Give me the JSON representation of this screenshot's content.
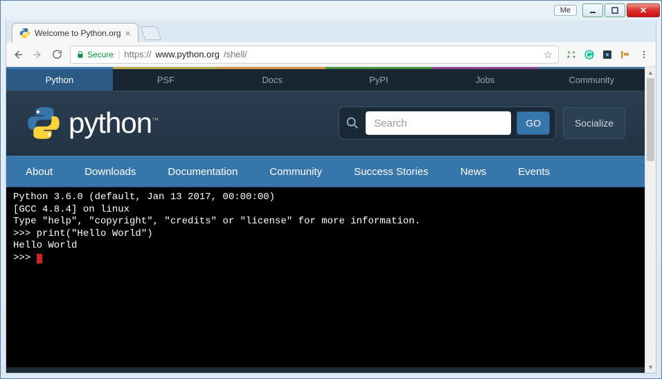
{
  "window": {
    "user_label": "Me"
  },
  "browser": {
    "tab_title": "Welcome to Python.org",
    "secure_label": "Secure",
    "url_scheme": "https://",
    "url_host": "www.python.org",
    "url_path": "/shell/"
  },
  "topnav": {
    "items": [
      "Python",
      "PSF",
      "Docs",
      "PyPI",
      "Jobs",
      "Community"
    ],
    "active_index": 0
  },
  "logo": {
    "text": "python",
    "tm": "™"
  },
  "search": {
    "placeholder": "Search",
    "go": "GO"
  },
  "socialize": {
    "label": "Socialize"
  },
  "mainnav": {
    "items": [
      "About",
      "Downloads",
      "Documentation",
      "Community",
      "Success Stories",
      "News",
      "Events"
    ]
  },
  "terminal": {
    "line1": "Python 3.6.0 (default, Jan 13 2017, 00:00:00)",
    "line2": "[GCC 4.8.4] on linux",
    "line3": "Type \"help\", \"copyright\", \"credits\" or \"license\" for more information.",
    "line4": ">>> print(\"Hello World\")",
    "line5": "Hello World",
    "line6": ">>> "
  }
}
